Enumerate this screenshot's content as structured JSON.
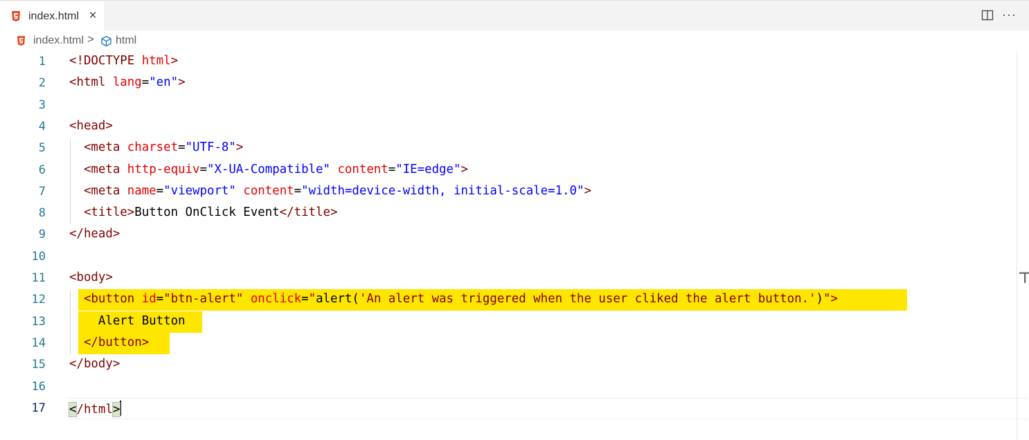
{
  "tab": {
    "label": "index.html",
    "close_glyph": "×",
    "icon": "html5-icon"
  },
  "actions": {
    "split_icon": "split-editor-icon",
    "more_glyph": "···"
  },
  "breadcrumb": {
    "file": "index.html",
    "separator": ">",
    "symbol": "html",
    "symbol_icon": "cube-icon"
  },
  "colors": {
    "tag": "#800000",
    "attribute": "#e50000",
    "string": "#0000ff",
    "line_number": "#237893",
    "highlight": "#ffe600",
    "html5_badge": "#e34c26"
  },
  "editor": {
    "active_line": 17,
    "lines": [
      {
        "n": "1",
        "tokens": [
          [
            "tg",
            "<!DOCTYPE "
          ],
          [
            "at",
            "html"
          ],
          [
            "tg",
            ">"
          ]
        ]
      },
      {
        "n": "2",
        "tokens": [
          [
            "tg",
            "<html "
          ],
          [
            "at",
            "lang"
          ],
          [
            "tx",
            "="
          ],
          [
            "st",
            "\"en\""
          ],
          [
            "tg",
            ">"
          ]
        ]
      },
      {
        "n": "3",
        "tokens": []
      },
      {
        "n": "4",
        "tokens": [
          [
            "tg",
            "<head>"
          ]
        ]
      },
      {
        "n": "5",
        "tokens": [
          [
            "tx",
            "  "
          ],
          [
            "tg",
            "<meta "
          ],
          [
            "at",
            "charset"
          ],
          [
            "tx",
            "="
          ],
          [
            "st",
            "\"UTF-8\""
          ],
          [
            "tg",
            ">"
          ]
        ]
      },
      {
        "n": "6",
        "tokens": [
          [
            "tx",
            "  "
          ],
          [
            "tg",
            "<meta "
          ],
          [
            "at",
            "http-equiv"
          ],
          [
            "tx",
            "="
          ],
          [
            "st",
            "\"X-UA-Compatible\""
          ],
          [
            "tx",
            " "
          ],
          [
            "at",
            "content"
          ],
          [
            "tx",
            "="
          ],
          [
            "st",
            "\"IE=edge\""
          ],
          [
            "tg",
            ">"
          ]
        ]
      },
      {
        "n": "7",
        "tokens": [
          [
            "tx",
            "  "
          ],
          [
            "tg",
            "<meta "
          ],
          [
            "at",
            "name"
          ],
          [
            "tx",
            "="
          ],
          [
            "st",
            "\"viewport\""
          ],
          [
            "tx",
            " "
          ],
          [
            "at",
            "content"
          ],
          [
            "tx",
            "="
          ],
          [
            "st",
            "\"width=device-width, initial-scale=1.0\""
          ],
          [
            "tg",
            ">"
          ]
        ]
      },
      {
        "n": "8",
        "tokens": [
          [
            "tx",
            "  "
          ],
          [
            "tg",
            "<title>"
          ],
          [
            "tx",
            "Button OnClick Event"
          ],
          [
            "tg",
            "</title>"
          ]
        ]
      },
      {
        "n": "9",
        "tokens": [
          [
            "tg",
            "</head>"
          ]
        ]
      },
      {
        "n": "10",
        "tokens": []
      },
      {
        "n": "11",
        "tokens": [
          [
            "tg",
            "<body>"
          ]
        ]
      },
      {
        "n": "12",
        "tokens": [
          [
            "tx",
            "  "
          ],
          [
            "tg",
            "<button "
          ],
          [
            "at",
            "id"
          ],
          [
            "tx",
            "="
          ],
          [
            "tg",
            "\"btn-alert\""
          ],
          [
            "tx",
            " "
          ],
          [
            "at",
            "onclick"
          ],
          [
            "tx",
            "="
          ],
          [
            "tg",
            "\""
          ],
          [
            "tx",
            "alert("
          ],
          [
            "tg",
            "'An alert was triggered when the user cliked the alert button.'"
          ],
          [
            "tx",
            ")"
          ],
          [
            "tg",
            "\">"
          ]
        ]
      },
      {
        "n": "13",
        "tokens": [
          [
            "tx",
            "    Alert Button"
          ]
        ]
      },
      {
        "n": "14",
        "tokens": [
          [
            "tx",
            "  "
          ],
          [
            "tg",
            "</button>"
          ]
        ]
      },
      {
        "n": "15",
        "tokens": [
          [
            "tg",
            "</body>"
          ]
        ]
      },
      {
        "n": "16",
        "tokens": []
      },
      {
        "n": "17",
        "tokens": [
          [
            "bk",
            "<"
          ],
          [
            "tg",
            "/html"
          ],
          [
            "bk",
            ">"
          ]
        ]
      }
    ]
  }
}
